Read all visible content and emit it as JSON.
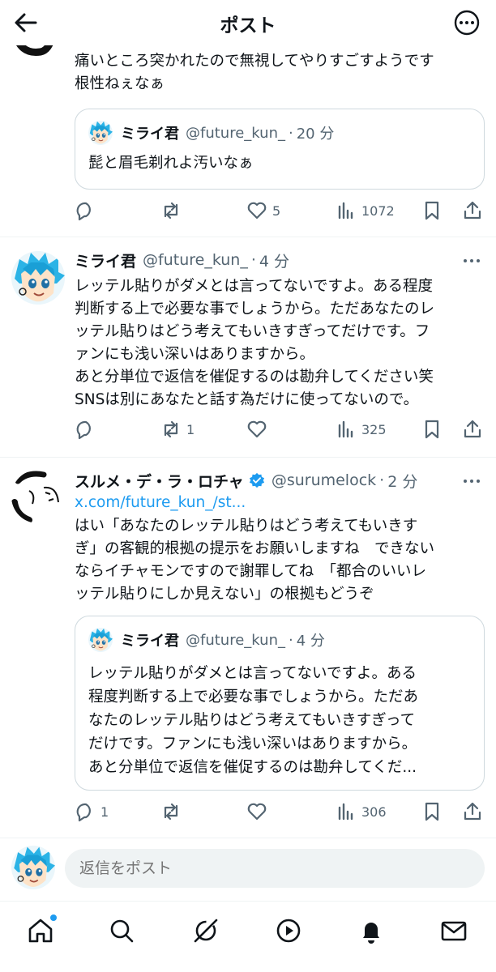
{
  "header": {
    "title": "ポスト"
  },
  "tweets": [
    {
      "body": "痛いところ突かれたので無視してやりすごすようです\n根性ねぇなぁ",
      "quote": {
        "name": "ミライ君",
        "handle": "@future_kun_",
        "time": "20 分",
        "text": "髭と眉毛剃れよ汚いなぁ"
      },
      "actions": {
        "replies": "",
        "retweets": "",
        "likes": "5",
        "views": "1072"
      }
    },
    {
      "name": "ミライ君",
      "handle": "@future_kun_",
      "time": "4 分",
      "body": "レッテル貼りがダメとは言ってないですよ。ある程度\n判断する上で必要な事でしょうから。ただあなたのレ\nッテル貼りはどう考えてもいきすぎってだけです。フ\nァンにも浅い深いはありますから。\nあと分単位で返信を催促するのは勘弁してください笑\nSNSは別にあなたと話す為だけに使ってないので。",
      "actions": {
        "replies": "",
        "retweets": "1",
        "likes": "",
        "views": "325"
      }
    },
    {
      "name": "スルメ・デ・ラ・ロチャ",
      "handle": "@surumelock",
      "time": "2 分",
      "link": "x.com/future_kun_/st...",
      "body": "はい「あなたのレッテル貼りはどう考えてもいきす\nぎ」の客観的根拠の提示をお願いしますね　できない\nならイチャモンですので謝罪してね　「都合のいいレ\nッテル貼りにしか見えない」の根拠もどうぞ",
      "quote": {
        "name": "ミライ君",
        "handle": "@future_kun_",
        "time": "4 分",
        "text": "レッテル貼りがダメとは言ってないですよ。ある\n程度判断する上で必要な事でしょうから。ただあ\nなたのレッテル貼りはどう考えてもいきすぎって\nだけです。ファンにも浅い深いはありますから。\nあと分単位で返信を催促するのは勘弁してくだ..."
      },
      "actions": {
        "replies": "1",
        "retweets": "",
        "likes": "",
        "views": "306"
      }
    }
  ],
  "reply": {
    "placeholder": "返信をポスト"
  },
  "tabs": [
    "home",
    "search",
    "grok",
    "video",
    "notifications",
    "messages"
  ],
  "colors": {
    "accent": "#1d9bf0",
    "text": "#0f1419",
    "muted": "#536471",
    "verified": "#1d9bf0"
  }
}
